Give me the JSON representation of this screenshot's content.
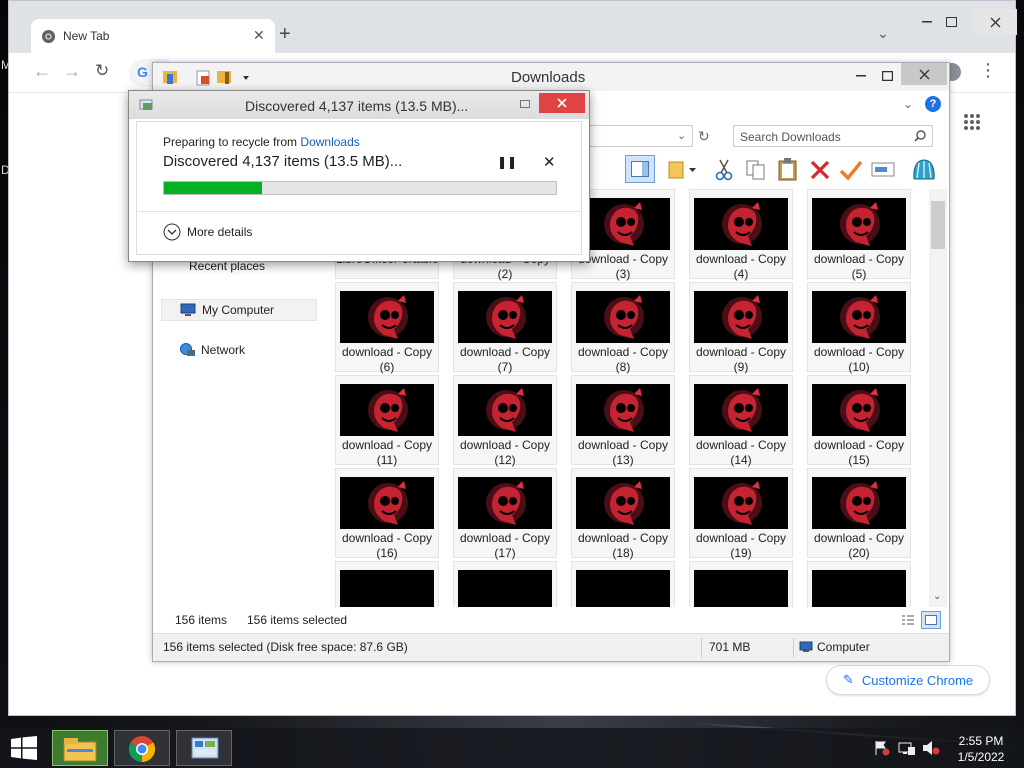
{
  "chrome": {
    "tab_title": "New Tab",
    "customize_label": "Customize Chrome"
  },
  "explorer": {
    "title": "Downloads",
    "search_placeholder": "Search Downloads",
    "nav": {
      "recent": "Recent places",
      "computer": "My Computer",
      "network": "Network"
    },
    "grid": [
      {
        "label": "LibreOfficePortable"
      },
      {
        "label": "download - Copy (2)"
      },
      {
        "label": "download - Copy (3)"
      },
      {
        "label": "download - Copy (4)"
      },
      {
        "label": "download - Copy (5)"
      },
      {
        "label": "download - Copy (6)"
      },
      {
        "label": "download - Copy (7)"
      },
      {
        "label": "download - Copy (8)"
      },
      {
        "label": "download - Copy (9)"
      },
      {
        "label": "download - Copy (10)"
      },
      {
        "label": "download - Copy (11)"
      },
      {
        "label": "download - Copy (12)"
      },
      {
        "label": "download - Copy (13)"
      },
      {
        "label": "download - Copy (14)"
      },
      {
        "label": "download - Copy (15)"
      },
      {
        "label": "download - Copy (16)"
      },
      {
        "label": "download - Copy (17)"
      },
      {
        "label": "download - Copy (18)"
      },
      {
        "label": "download - Copy (19)"
      },
      {
        "label": "download - Copy (20)"
      }
    ],
    "status": {
      "count": "156 items",
      "selected": "156 items selected",
      "bar_left": "156 items selected (Disk free space: 87.6 GB)",
      "size": "701 MB",
      "location": "Computer"
    }
  },
  "dialog": {
    "title": "Discovered 4,137 items (13.5 MB)...",
    "preparing_text": "Preparing to recycle from",
    "preparing_link": "Downloads",
    "heading": "Discovered 4,137 items (13.5 MB)...",
    "progress": 0.25,
    "more_details": "More details"
  },
  "taskbar": {
    "time": "2:55 PM",
    "date": "1/5/2022"
  },
  "desktop": {
    "edge_letter_1": "M",
    "edge_letter_2": "D"
  },
  "colors": {
    "progress_fill": "#06b025",
    "link": "#1a73e8",
    "close_red": "#e04343"
  }
}
